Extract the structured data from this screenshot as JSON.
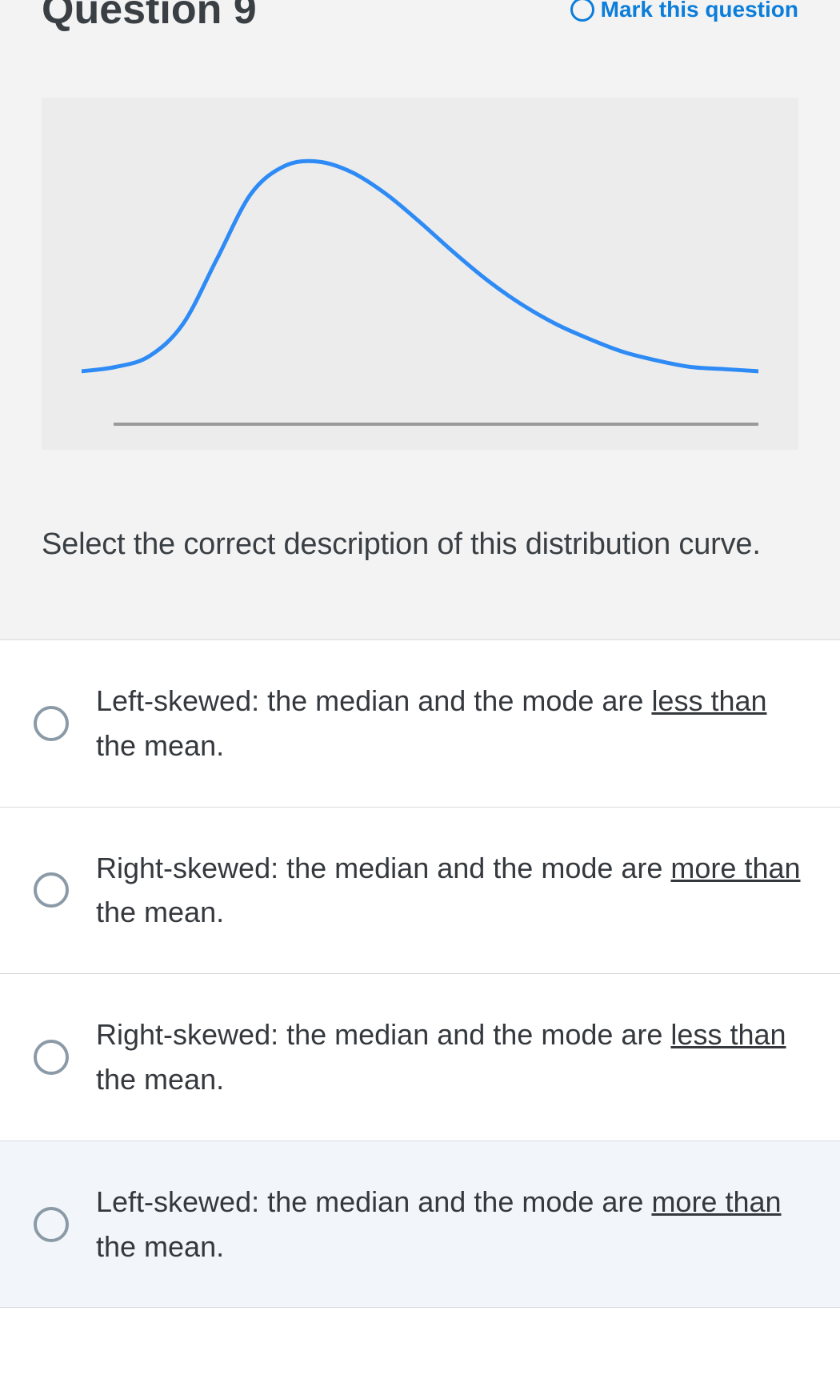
{
  "header": {
    "title": "Question 9",
    "mark_label": "Mark this question"
  },
  "prompt": "Select the correct description of this distribution curve.",
  "options": [
    {
      "prefix": "Left-skewed: the median and the mode are ",
      "underlined": "less than",
      "suffix": " the mean."
    },
    {
      "prefix": "Right-skewed: the median and the mode are ",
      "underlined": "more than",
      "suffix": " the mean."
    },
    {
      "prefix": "Right-skewed: the median and the mode are ",
      "underlined": "less than",
      "suffix": " the mean."
    },
    {
      "prefix": "Left-skewed: the median and the mode are ",
      "underlined": "more than",
      "suffix": " the mean."
    }
  ],
  "chart_data": {
    "type": "line",
    "title": "",
    "xlabel": "",
    "ylabel": "",
    "description": "Right-skewed unimodal distribution curve",
    "x": [
      0.0,
      0.05,
      0.1,
      0.15,
      0.2,
      0.25,
      0.3,
      0.35,
      0.4,
      0.45,
      0.5,
      0.55,
      0.6,
      0.65,
      0.7,
      0.75,
      0.8,
      0.85,
      0.9,
      0.95,
      1.0
    ],
    "y": [
      0.03,
      0.05,
      0.1,
      0.25,
      0.55,
      0.85,
      0.98,
      1.0,
      0.95,
      0.85,
      0.72,
      0.58,
      0.45,
      0.34,
      0.25,
      0.18,
      0.12,
      0.08,
      0.05,
      0.04,
      0.03
    ],
    "xlim": [
      0,
      1
    ],
    "ylim": [
      0,
      1
    ]
  },
  "colors": {
    "accent": "#0b7dda",
    "curve": "#2e8bf5",
    "axis": "#9a9a9a"
  }
}
